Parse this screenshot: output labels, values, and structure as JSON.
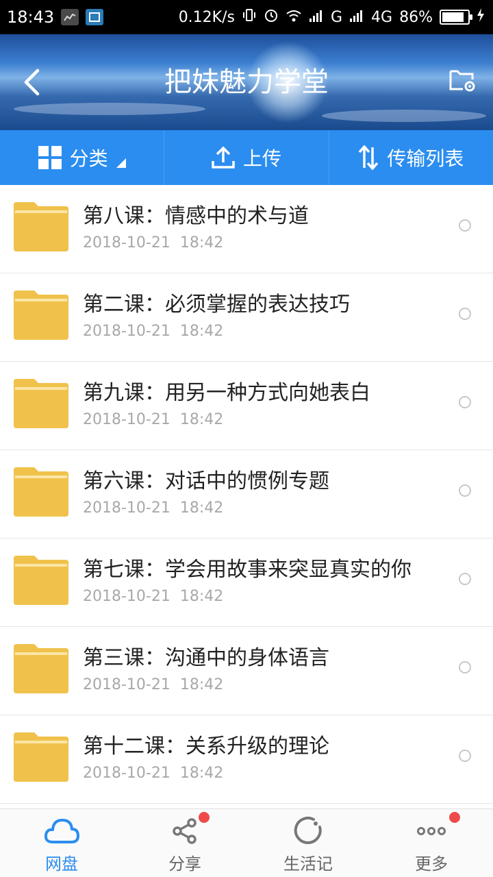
{
  "status_bar": {
    "time": "18:43",
    "net_speed": "0.12K/s",
    "network_g": "G",
    "network_4g": "4G",
    "battery": "86%",
    "battery_level": 0.86
  },
  "header": {
    "title": "把妹魅力学堂"
  },
  "toolbar": {
    "category": "分类",
    "upload": "上传",
    "transfer_list": "传输列表"
  },
  "folders": [
    {
      "name": "第八课：情感中的术与道",
      "date": "2018-10-21",
      "time": "18:42"
    },
    {
      "name": "第二课：必须掌握的表达技巧",
      "date": "2018-10-21",
      "time": "18:42"
    },
    {
      "name": "第九课：用另一种方式向她表白",
      "date": "2018-10-21",
      "time": "18:42"
    },
    {
      "name": "第六课：对话中的惯例专题",
      "date": "2018-10-21",
      "time": "18:42"
    },
    {
      "name": "第七课：学会用故事来突显真实的你",
      "date": "2018-10-21",
      "time": "18:42"
    },
    {
      "name": "第三课：沟通中的身体语言",
      "date": "2018-10-21",
      "time": "18:42"
    },
    {
      "name": "第十二课：关系升级的理论",
      "date": "2018-10-21",
      "time": "18:42"
    }
  ],
  "bottom_nav": {
    "netdisk": "网盘",
    "share": "分享",
    "life": "生活记",
    "more": "更多"
  },
  "colors": {
    "accent": "#2b8def",
    "folder": "#f0c24b",
    "badge": "#ef4a4a"
  }
}
